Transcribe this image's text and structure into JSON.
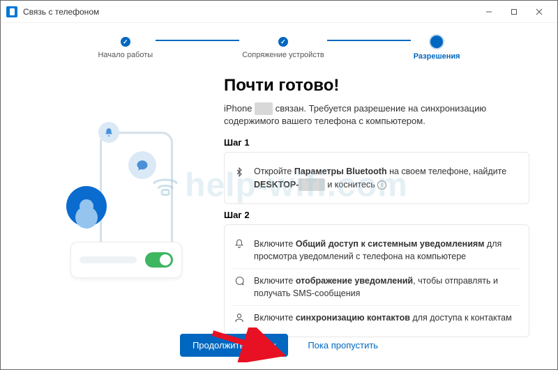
{
  "window": {
    "title": "Связь с телефоном"
  },
  "stepper": {
    "steps": [
      {
        "label": "Начало работы"
      },
      {
        "label": "Сопряжение устройств"
      },
      {
        "label": "Разрешения"
      }
    ]
  },
  "main": {
    "heading": "Почти готово!",
    "desc_prefix": "iPhone ",
    "desc_redacted": "——",
    "desc_suffix": " связан. Требуется разрешение на синхронизацию содержимого вашего телефона с компьютером.",
    "step1_title": "Шаг 1",
    "step1_text_a": "Откройте ",
    "step1_bold_a": "Параметры Bluetooth",
    "step1_text_b": " на своем телефоне, найдите ",
    "step1_bold_b": "DESKTOP-",
    "step1_redacted": "———",
    "step1_text_c": " и коснитесь ",
    "step2_title": "Шаг 2",
    "rows": [
      {
        "icon": "bell",
        "pre": "Включите ",
        "bold": "Общий доступ к системным уведомлениям",
        "post": " для просмотра уведомлений с телефона на компьютере"
      },
      {
        "icon": "chat",
        "pre": "Включите ",
        "bold": "отображение уведомлений",
        "post": ", чтобы отправлять и получать SMS-сообщения"
      },
      {
        "icon": "contact",
        "pre": "Включите ",
        "bold": "синхронизацию контактов",
        "post": " для доступа к контактам"
      }
    ]
  },
  "footer": {
    "continue": "Продолжить работу",
    "skip": "Пока пропустить"
  },
  "watermark": "help-wifi.com",
  "colors": {
    "accent": "#0067c0"
  }
}
